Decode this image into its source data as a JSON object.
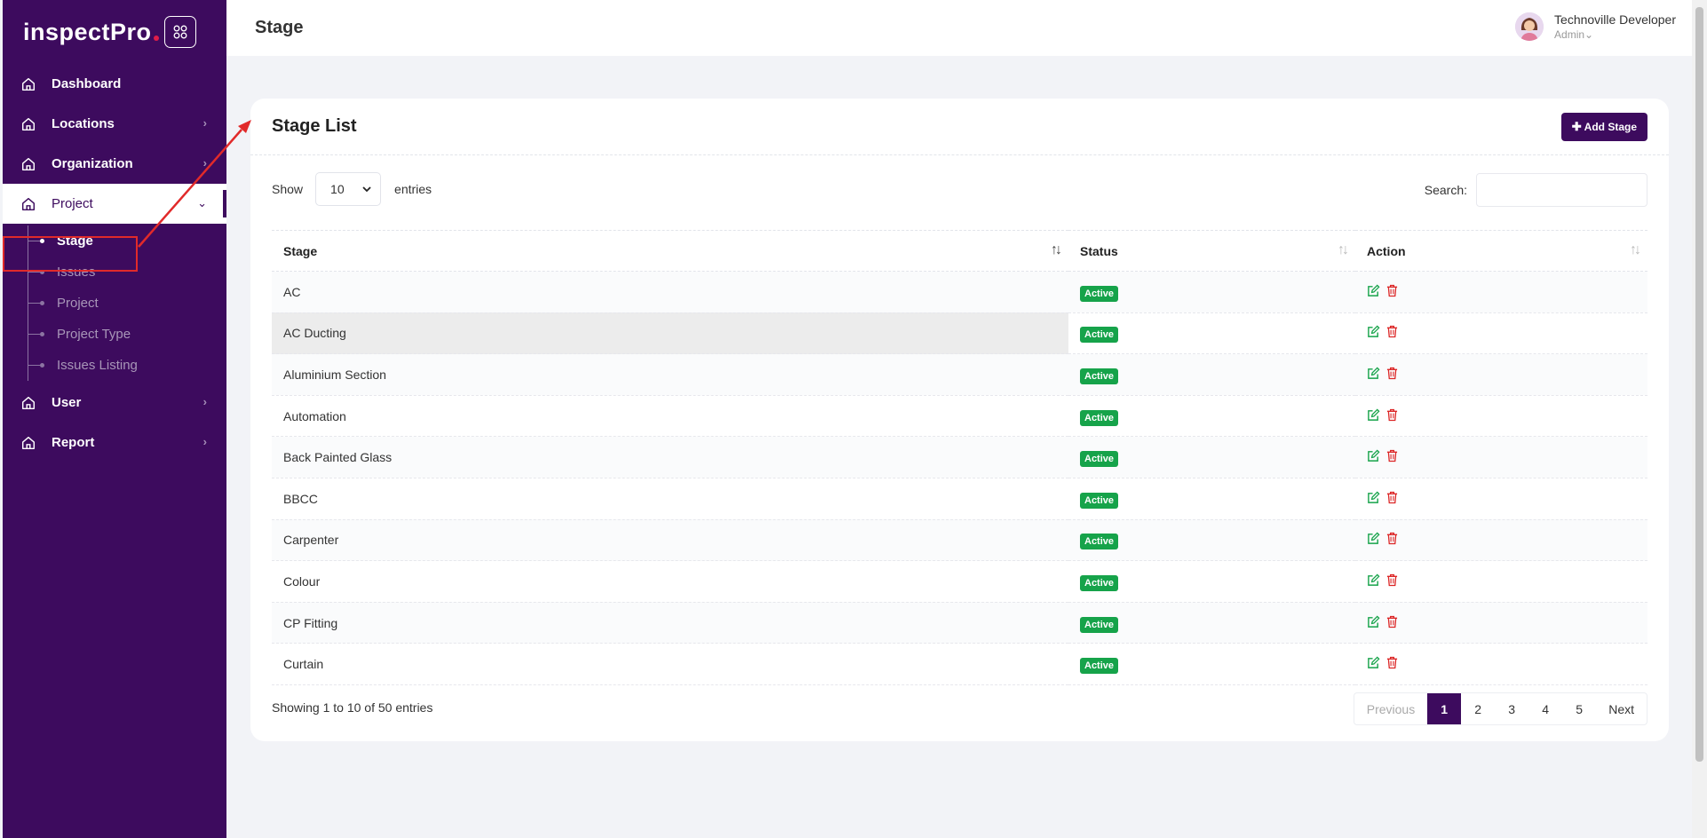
{
  "brand": {
    "name": "inspectPro"
  },
  "sidebar": {
    "items": [
      {
        "label": "Dashboard",
        "icon": "home-icon",
        "chevron": false
      },
      {
        "label": "Locations",
        "icon": "home-icon",
        "chevron": true
      },
      {
        "label": "Organization",
        "icon": "home-icon",
        "chevron": true
      },
      {
        "label": "Project",
        "icon": "home-icon",
        "chevron": true,
        "expanded": true
      }
    ],
    "submenu": [
      "Stage",
      "Issues",
      "Project",
      "Project Type",
      "Issues Listing"
    ],
    "bottom_items": [
      {
        "label": "User",
        "icon": "home-icon",
        "chevron": true
      },
      {
        "label": "Report",
        "icon": "home-icon",
        "chevron": true
      }
    ]
  },
  "header": {
    "title": "Stage",
    "user_name": "Technoville Developer",
    "user_role": "Admin"
  },
  "card": {
    "title": "Stage List",
    "add_label": "Add Stage"
  },
  "controls": {
    "show_label": "Show",
    "entries_value": "10",
    "entries_label": "entries",
    "search_label": "Search:"
  },
  "table": {
    "columns": [
      "Stage",
      "Status",
      "Action"
    ],
    "rows": [
      {
        "stage": "AC",
        "status": "Active"
      },
      {
        "stage": "AC Ducting",
        "status": "Active"
      },
      {
        "stage": "Aluminium Section",
        "status": "Active"
      },
      {
        "stage": "Automation",
        "status": "Active"
      },
      {
        "stage": "Back Painted Glass",
        "status": "Active"
      },
      {
        "stage": "BBCC",
        "status": "Active"
      },
      {
        "stage": "Carpenter",
        "status": "Active"
      },
      {
        "stage": "Colour",
        "status": "Active"
      },
      {
        "stage": "CP Fitting",
        "status": "Active"
      },
      {
        "stage": "Curtain",
        "status": "Active"
      }
    ]
  },
  "footer": {
    "info": "Showing 1 to 10 of 50 entries",
    "prev": "Previous",
    "next": "Next",
    "pages": [
      "1",
      "2",
      "3",
      "4",
      "5"
    ],
    "current_page": "1"
  },
  "colors": {
    "primary": "#3d0b5e",
    "active_badge": "#16a34a",
    "annotation": "#e12a2a"
  }
}
